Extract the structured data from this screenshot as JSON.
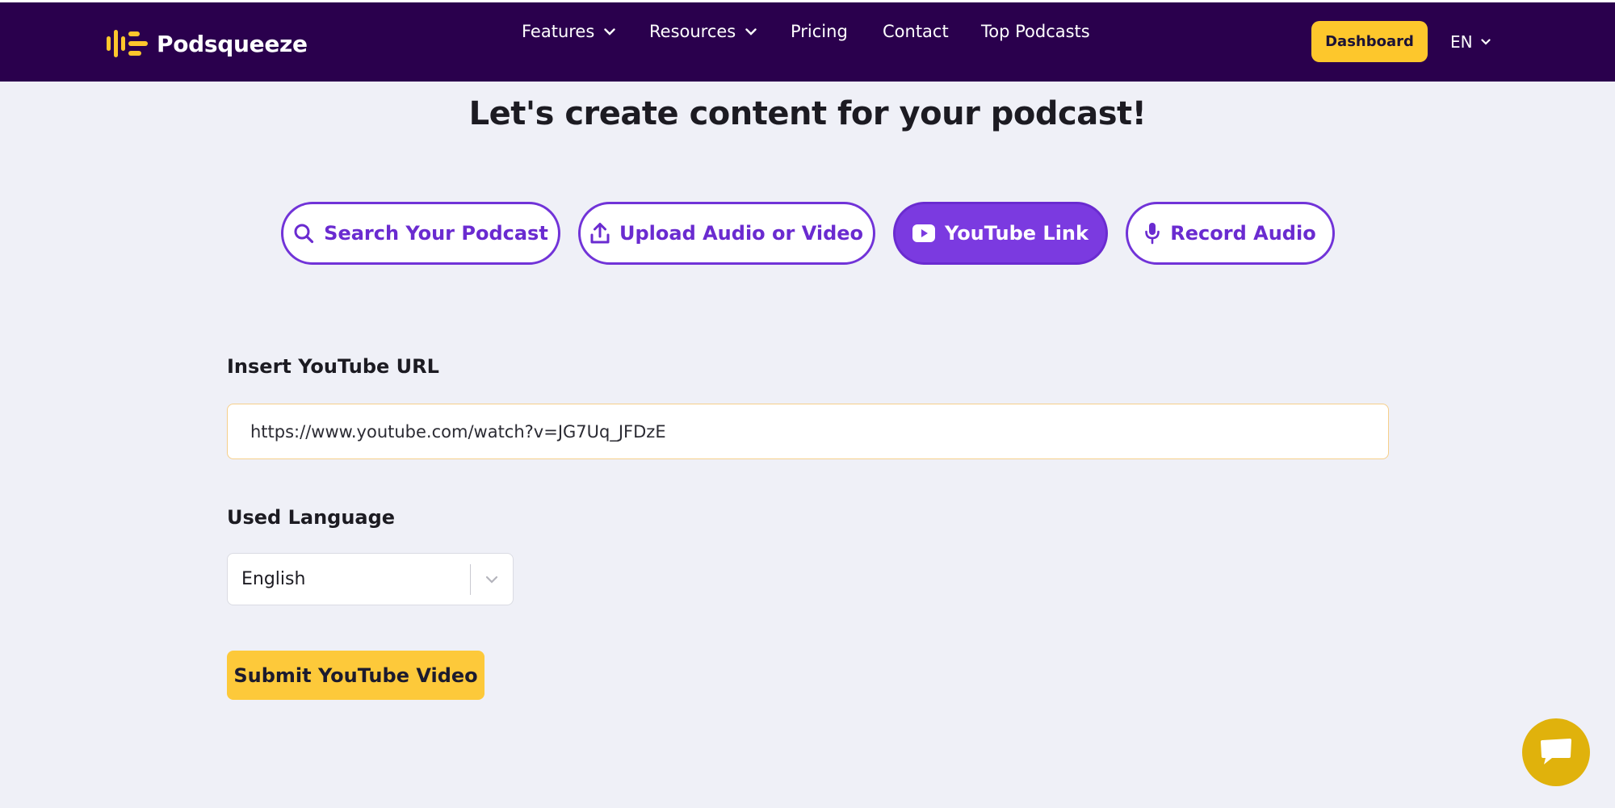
{
  "brand": {
    "name": "Podsqueeze",
    "logo_icon": "equalizer-logo-icon",
    "accent": "#fdc72c",
    "nav_bg": "#2a004d"
  },
  "nav": {
    "items": [
      {
        "label": "Features",
        "has_dropdown": true
      },
      {
        "label": "Resources",
        "has_dropdown": true
      },
      {
        "label": "Pricing",
        "has_dropdown": false
      },
      {
        "label": "Contact",
        "has_dropdown": false
      },
      {
        "label": "Top Podcasts",
        "has_dropdown": false
      }
    ],
    "dashboard_label": "Dashboard",
    "language": "EN"
  },
  "main": {
    "title": "Let's create content for your podcast!",
    "tabs": [
      {
        "label": "Search Your Podcast",
        "icon": "search-icon",
        "active": false
      },
      {
        "label": "Upload Audio or Video",
        "icon": "upload-icon",
        "active": false
      },
      {
        "label": "YouTube Link",
        "icon": "youtube-icon",
        "active": true
      },
      {
        "label": "Record Audio",
        "icon": "microphone-icon",
        "active": false
      }
    ],
    "url_label": "Insert YouTube URL",
    "url_value": "https://www.youtube.com/watch?v=JG7Uq_JFDzE",
    "language_label": "Used Language",
    "language_value": "English",
    "submit_label": "Submit YouTube Video"
  },
  "chat": {
    "icon": "chat-bubble-icon"
  },
  "colors": {
    "tab_accent": "#7b3ae0",
    "page_bg": "#eff0f7"
  }
}
